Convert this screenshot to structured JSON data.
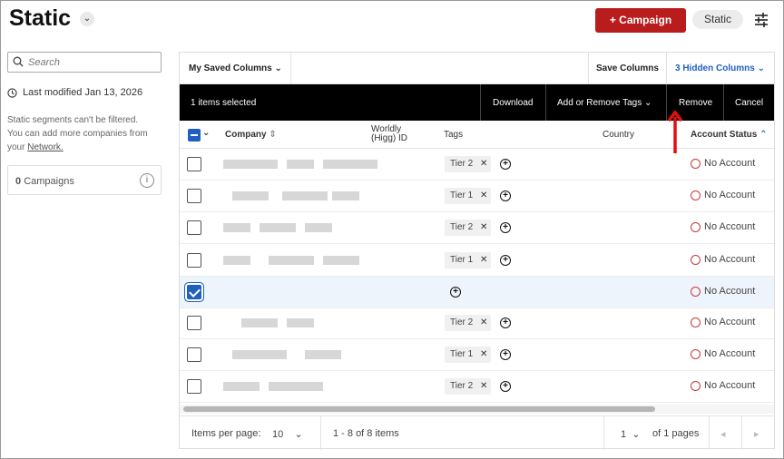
{
  "page": {
    "title": "Static"
  },
  "header": {
    "campaign_button": "+ Campaign",
    "static_pill": "Static"
  },
  "sidebar": {
    "search_placeholder": "Search",
    "last_modified": "Last modified Jan 13, 2026",
    "note_line1": "Static segments can't be filtered.",
    "note_line2": "You can add more companies from",
    "note_line3_prefix": "your",
    "note_link": "Network.",
    "campaigns_count": "0",
    "campaigns_label": "Campaigns"
  },
  "toolbar": {
    "saved_columns": "My Saved Columns",
    "save_columns": "Save Columns",
    "hidden_columns": "3 Hidden Columns"
  },
  "selection_bar": {
    "selected_text": "1 items selected",
    "download": "Download",
    "add_remove_tags": "Add or Remove Tags",
    "remove": "Remove",
    "cancel": "Cancel"
  },
  "columns": {
    "company": "Company",
    "worldly_line1": "Worldly",
    "worldly_line2": "(Higg) ID",
    "tags": "Tags",
    "country": "Country",
    "account_status": "Account Status"
  },
  "rows": [
    {
      "checked": false,
      "tag": "Tier 2",
      "status": "No Account"
    },
    {
      "checked": false,
      "tag": "Tier 1",
      "status": "No Account"
    },
    {
      "checked": false,
      "tag": "Tier 2",
      "status": "No Account"
    },
    {
      "checked": false,
      "tag": "Tier 1",
      "status": "No Account"
    },
    {
      "checked": true,
      "tag": "",
      "status": "No Account"
    },
    {
      "checked": false,
      "tag": "Tier 2",
      "status": "No Account"
    },
    {
      "checked": false,
      "tag": "Tier 1",
      "status": "No Account"
    },
    {
      "checked": false,
      "tag": "Tier 2",
      "status": "No Account"
    }
  ],
  "pager": {
    "items_per_page_label": "Items per page:",
    "items_per_page": "10",
    "range": "1 - 8 of 8 items",
    "current_page": "1",
    "of_pages": "of 1 pages"
  },
  "colors": {
    "accent": "#b81c1c",
    "link": "#1f5fbf",
    "status_dot": "#c73a3a"
  },
  "icons": [
    "chevron-down-icon",
    "filter-sliders-icon",
    "search-icon",
    "clock-icon",
    "info-icon",
    "sort-icon",
    "tag-remove-icon",
    "add-tag-icon",
    "status-circle-icon",
    "prev-page-icon",
    "next-page-icon",
    "red-arrow-annotation-icon"
  ]
}
